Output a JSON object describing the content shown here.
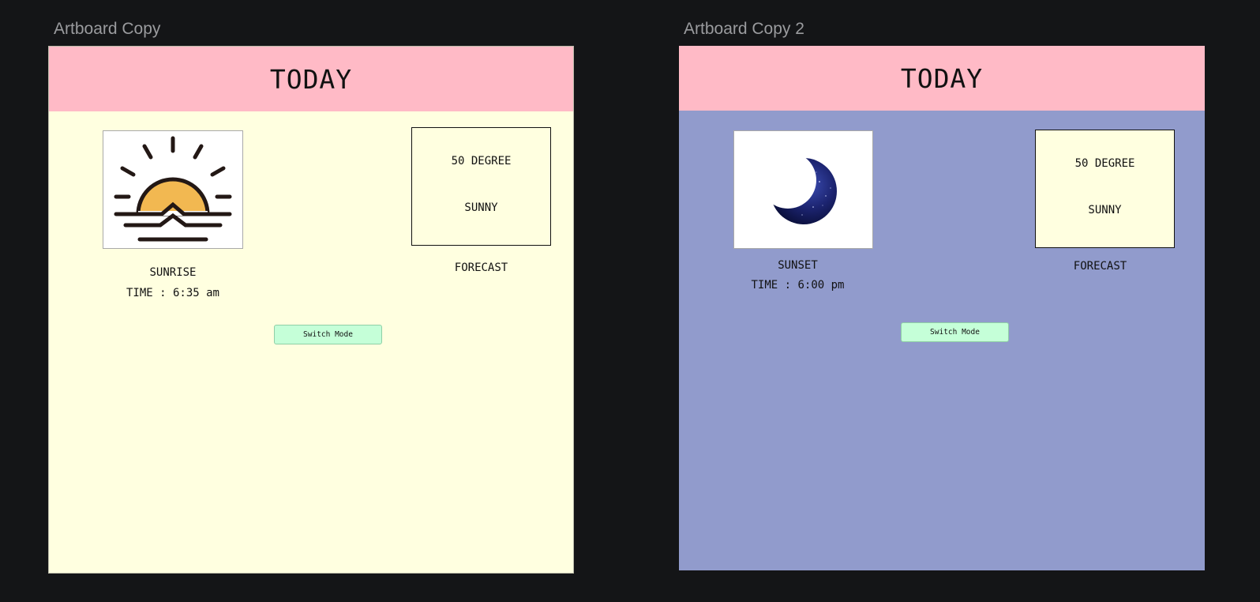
{
  "artboards": [
    {
      "name": "Artboard Copy",
      "mode": "day",
      "background": "#ffffe0",
      "header": {
        "title": "TODAY",
        "color": "#ffbac6"
      },
      "event": {
        "label": "SUNRISE",
        "time": "TIME : 6:35 am",
        "icon": "sunrise-icon"
      },
      "forecast": {
        "temperature": "50 DEGREE",
        "condition": "SUNNY",
        "label": "FORECAST"
      },
      "switch_button": {
        "label": "Switch Mode",
        "color": "#c5ffd8"
      }
    },
    {
      "name": "Artboard Copy 2",
      "mode": "night",
      "background": "#919bcc",
      "header": {
        "title": "TODAY",
        "color": "#ffbac6"
      },
      "event": {
        "label": "SUNSET",
        "time": "TIME : 6:00 pm",
        "icon": "moon-icon"
      },
      "forecast": {
        "temperature": "50 DEGREE",
        "condition": "SUNNY",
        "label": "FORECAST"
      },
      "switch_button": {
        "label": "Switch Mode",
        "color": "#c5ffd8"
      }
    }
  ]
}
